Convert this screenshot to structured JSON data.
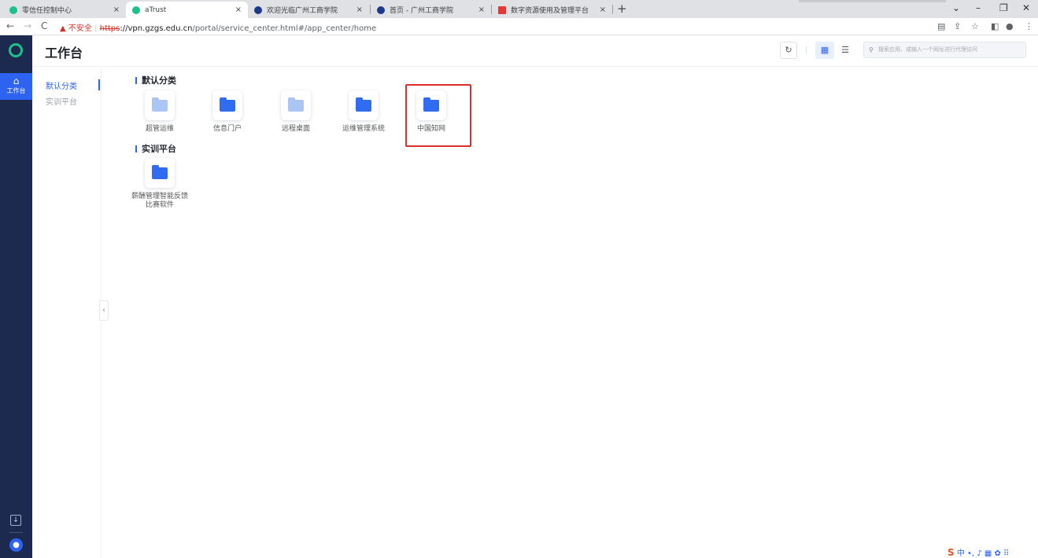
{
  "browser": {
    "tabs": [
      {
        "title": "零信任控制中心",
        "favicon_color": "#1ec08b"
      },
      {
        "title": "aTrust",
        "favicon_color": "#1ec08b"
      },
      {
        "title": "欢迎光临广州工商学院",
        "favicon_color": "#1b3a8c"
      },
      {
        "title": "首页 - 广州工商学院",
        "favicon_color": "#1b3a8c"
      },
      {
        "title": "数字资源使用及管理平台",
        "favicon_color": "#e53935"
      }
    ],
    "close_glyph": "×",
    "new_tab_glyph": "+",
    "address": {
      "warning": "▲ 不安全",
      "scheme": "https",
      "host": "://vpn.gzgs.edu.cn",
      "path": "/portal/service_center.html#/app_center/home"
    }
  },
  "rail": {
    "home_label": "工作台"
  },
  "header": {
    "title": "工作台",
    "search_placeholder": "搜索应用、或输入一个网址进行代理访问"
  },
  "categories": [
    {
      "label": "默认分类",
      "active": true
    },
    {
      "label": "实训平台",
      "active": false
    }
  ],
  "sections": [
    {
      "title": "默认分类",
      "apps": [
        {
          "name": "超管运维",
          "folder": "light"
        },
        {
          "name": "信息门户",
          "folder": "dark"
        },
        {
          "name": "远程桌面",
          "folder": "light"
        },
        {
          "name": "运维管理系统",
          "folder": "dark"
        },
        {
          "name": "中国知网",
          "folder": "dark",
          "highlighted": true
        }
      ]
    },
    {
      "title": "实训平台",
      "apps": [
        {
          "name": "薪酬管理智能反馈比赛软件",
          "folder": "dark"
        }
      ]
    }
  ],
  "ime": {
    "label": "中 •, ♪ ▦ ✿ ⠿"
  },
  "colors": {
    "accent": "#2d63f0",
    "rail_bg": "#1b2a4e",
    "highlight_border": "#e02b2b"
  }
}
